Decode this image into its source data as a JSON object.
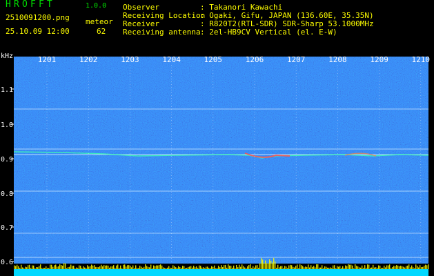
{
  "header": {
    "brand": "HROFFT",
    "version": "1.0.0",
    "filename": "2510091200.png",
    "datetime": "25.10.09 12:00",
    "detection_label": "meteor",
    "detection_count": "62"
  },
  "meta": {
    "observer_label": "Observer",
    "observer": ": Takanori Kawachi",
    "location_label": "Receiving Location",
    "location": ": Ogaki, Gifu, JAPAN (136.60E, 35.35N)",
    "receiver_label": "Receiver",
    "receiver": ": R820T2(RTL-SDR) SDR-Sharp 53.1000MHz",
    "antenna_label": "Receiving antenna",
    "antenna": ": 2el-HB9CV Vertical (el. E-W)"
  },
  "axis": {
    "y_unit": "kHz",
    "y_ticks": [
      "1.1",
      "1.0",
      "0.9",
      "0.8",
      "0.7",
      "0.6"
    ],
    "x_ticks": [
      "1201",
      "1202",
      "1203",
      "1204",
      "1205",
      "1206",
      "1207",
      "1208",
      "1209",
      "1210"
    ]
  },
  "colors": {
    "background": "#000000",
    "header_text": "#ffff00",
    "brand_text": "#00e000",
    "spectrogram_base": "#001a80",
    "signal_line": "#ffffff",
    "bottom_bar": "#00d8ff",
    "peak_bar": "#ffff00"
  }
}
